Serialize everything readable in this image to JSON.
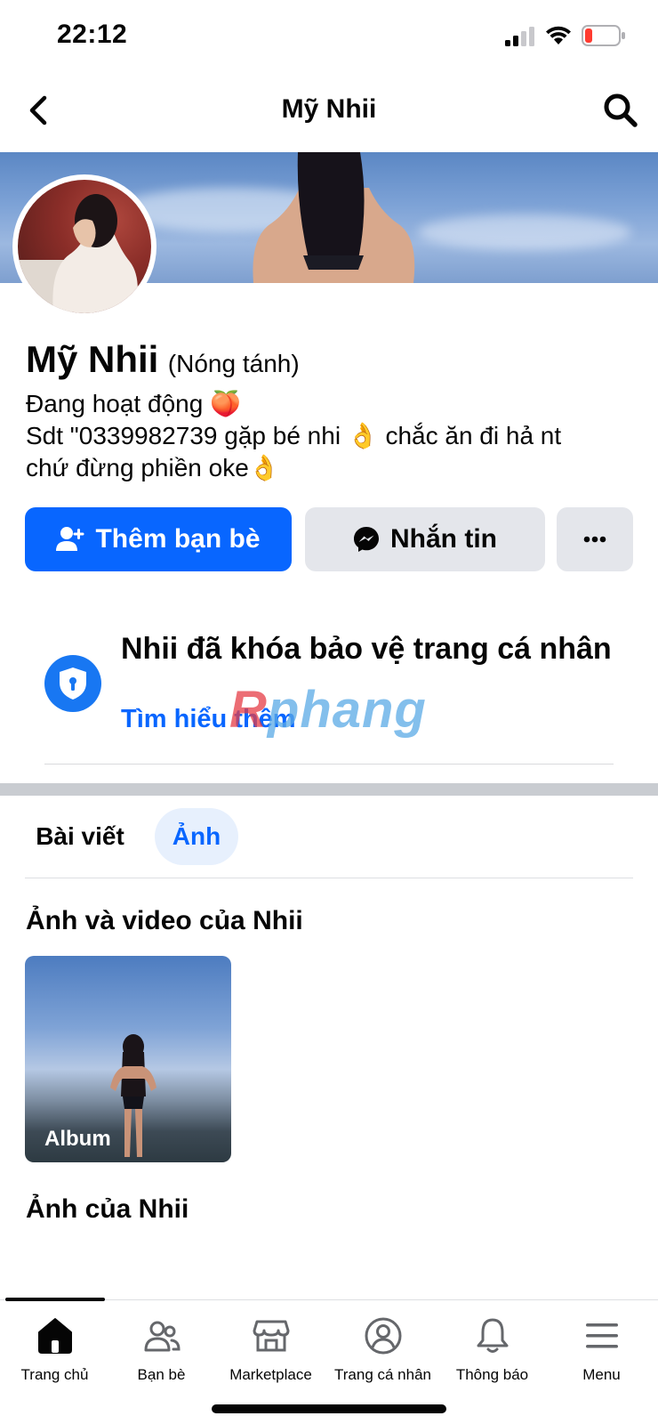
{
  "status_bar": {
    "time": "22:12"
  },
  "nav": {
    "title": "Mỹ Nhii"
  },
  "profile": {
    "name": "Mỹ Nhii",
    "alt_name": "(Nóng tánh)",
    "bio": [
      "Đang hoạt động 🍑",
      "Sdt \"0339982739 gặp bé nhi 👌 chắc ăn đi hả nt",
      "chứ đừng phiền oke👌"
    ]
  },
  "actions": {
    "add_friend": "Thêm bạn bè",
    "message": "Nhắn tin",
    "more": "more"
  },
  "lock_notice": {
    "title": "Nhii đã khóa bảo vệ trang cá nhân",
    "link": "Tìm hiểu thêm"
  },
  "watermark": {
    "first": "R",
    "rest": "phang"
  },
  "tabs": {
    "posts": "Bài viết",
    "photos": "Ảnh"
  },
  "photos_section": {
    "title": "Ảnh và video của Nhii",
    "album_label": "Album",
    "photos_title": "Ảnh của Nhii"
  },
  "tabbar": {
    "items": [
      {
        "label": "Trang chủ",
        "icon": "home-icon",
        "active": true
      },
      {
        "label": "Bạn bè",
        "icon": "friends-icon",
        "active": false
      },
      {
        "label": "Marketplace",
        "icon": "marketplace-icon",
        "active": false
      },
      {
        "label": "Trang cá nhân",
        "icon": "profile-icon",
        "active": false
      },
      {
        "label": "Thông báo",
        "icon": "bell-icon",
        "active": false
      },
      {
        "label": "Menu",
        "icon": "menu-icon",
        "active": false
      }
    ]
  },
  "colors": {
    "primary": "#0866ff",
    "button_gray": "#e4e6eb",
    "tab_active_bg": "#e7f0fd",
    "battery_low": "#ff3b30"
  }
}
